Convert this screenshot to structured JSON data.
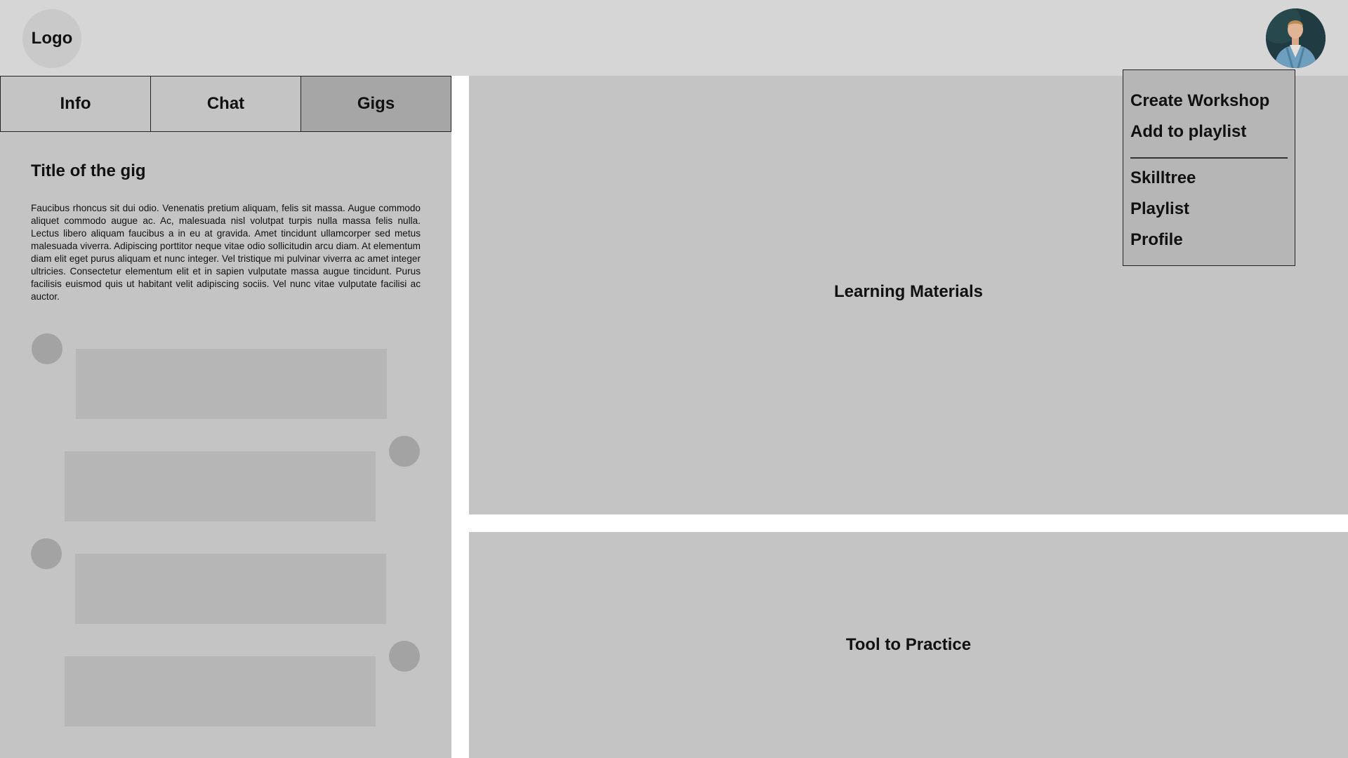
{
  "header": {
    "logo_label": "Logo"
  },
  "tabs": [
    {
      "label": "Info",
      "active": false
    },
    {
      "label": "Chat",
      "active": false
    },
    {
      "label": "Gigs",
      "active": true
    }
  ],
  "gig": {
    "title": "Title of the gig",
    "body": "Faucibus rhoncus sit dui odio. Venenatis pretium aliquam, felis sit massa. Augue commodo aliquet commodo augue ac. Ac, malesuada nisl volutpat turpis nulla massa felis nulla. Lectus libero aliquam faucibus a in eu at gravida. Amet tincidunt ullamcorper sed metus malesuada viverra. Adipiscing porttitor neque vitae odio sollicitudin arcu diam. At elementum diam elit eget purus aliquam et nunc integer. Vel tristique mi pulvinar viverra ac amet integer ultricies. Consectetur elementum elit et in sapien vulputate massa augue tincidunt. Purus facilisis euismod quis ut habitant velit adipiscing sociis. Vel nunc vitae vulputate facilisi ac auctor."
  },
  "panels": {
    "learning_label": "Learning Materials",
    "tool_label": "Tool to Practice"
  },
  "dropdown": {
    "items_top": [
      "Create Workshop",
      "Add to playlist"
    ],
    "items_bottom": [
      "Skilltree",
      "Playlist",
      "Profile"
    ]
  },
  "colors": {
    "header_bg": "#d6d6d6",
    "panel_bg": "#c4c4c4",
    "active_tab_bg": "#a6a6a6",
    "menu_bg": "#b6b6b6"
  },
  "icons": {
    "avatar": "user-avatar-photo",
    "logo": "logo-circle"
  }
}
